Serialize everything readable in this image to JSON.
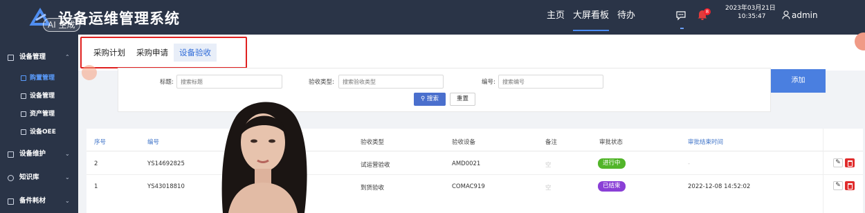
{
  "header": {
    "title": "设备运维管理系统",
    "ai_badge": "AI 生成",
    "nav": [
      "主页",
      "大屏看板",
      "待办"
    ],
    "active_nav": "大屏看板",
    "notification_count": "8",
    "date": "2023年03月21日",
    "time": "10:35:47",
    "username": "admin"
  },
  "sidebar": {
    "sections": [
      {
        "label": "设备管理",
        "expanded": true,
        "icon": "monitor-icon"
      },
      {
        "label": "设备维护",
        "expanded": false,
        "icon": "maintenance-icon"
      },
      {
        "label": "知识库",
        "expanded": false,
        "icon": "knowledge-icon"
      },
      {
        "label": "备件耗材",
        "expanded": false,
        "icon": "parts-icon"
      }
    ],
    "sub_items": [
      {
        "label": "购置管理",
        "active": true
      },
      {
        "label": "设备管理",
        "active": false
      },
      {
        "label": "资产管理",
        "active": false
      },
      {
        "label": "设备OEE",
        "active": false
      }
    ]
  },
  "tabs": [
    "采购计划",
    "采购申请",
    "设备验收"
  ],
  "active_tab": "设备验收",
  "search": {
    "fields": [
      {
        "label": "标题:",
        "placeholder": "搜索标题"
      },
      {
        "label": "验收类型:",
        "placeholder": "搜索验收类型"
      },
      {
        "label": "编号:",
        "placeholder": "搜索编号"
      }
    ],
    "search_label": "搜索",
    "reset_label": "重置",
    "add_label": "添加"
  },
  "table": {
    "columns": [
      "序号",
      "编号",
      "验收类型",
      "验收设备",
      "备注",
      "审批状态",
      "审批结束时间"
    ],
    "rows": [
      {
        "index": "2",
        "code": "YS14692825",
        "type": "试运营验收",
        "device": "AMD0021",
        "note": "空",
        "status": "进行中",
        "status_color": "#52b52a",
        "end_time": "-"
      },
      {
        "index": "1",
        "code": "YS43018810",
        "type": "到货验收",
        "device": "COMAC919",
        "note": "空",
        "status": "已结束",
        "status_color": "#8a3fd6",
        "end_time": "2022-12-08 14:52:02"
      }
    ]
  },
  "colors": {
    "header_bg": "#2a3447",
    "primary": "#4a7fe0",
    "highlight_box": "#e0201f"
  }
}
